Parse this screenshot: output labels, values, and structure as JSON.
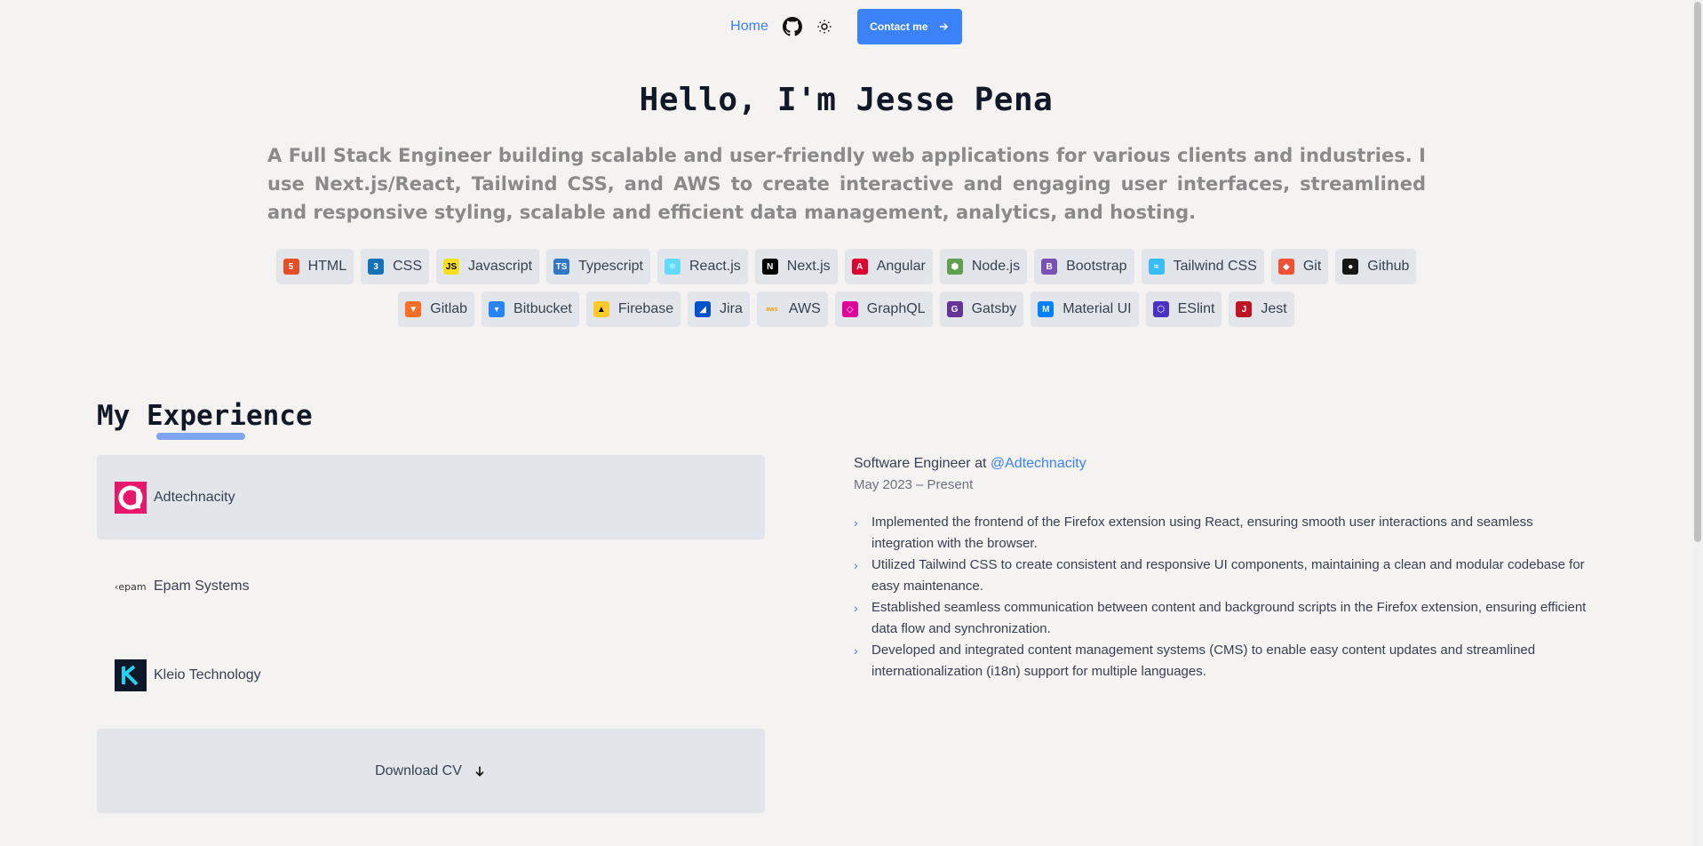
{
  "nav": {
    "home_label": "Home",
    "contact_label": "Contact me",
    "github_icon": "github-icon",
    "theme_icon": "sun-icon"
  },
  "hero": {
    "title": "Hello, I'm Jesse Pena",
    "subtitle": "A Full Stack Engineer building scalable and user-friendly web applications for various clients and industries. I use Next.js/React, Tailwind CSS, and AWS to create interactive and engaging user interfaces, streamlined and responsive styling, scalable and efficient data management, analytics, and hosting."
  },
  "skills": {
    "row1": [
      {
        "label": "HTML",
        "icon": "html5-icon",
        "color": "#e34f26",
        "glyph": "5"
      },
      {
        "label": "CSS",
        "icon": "css3-icon",
        "color": "#1572b6",
        "glyph": "3"
      },
      {
        "label": "Javascript",
        "icon": "javascript-icon",
        "color": "#f7df1e",
        "glyph": "JS"
      },
      {
        "label": "Typescript",
        "icon": "typescript-icon",
        "color": "#3178c6",
        "glyph": "TS"
      },
      {
        "label": "React.js",
        "icon": "react-icon",
        "color": "#61dafb",
        "glyph": "⚛"
      },
      {
        "label": "Next.js",
        "icon": "nextjs-icon",
        "color": "#000000",
        "glyph": "N"
      },
      {
        "label": "Angular",
        "icon": "angular-icon",
        "color": "#dd0031",
        "glyph": "A"
      },
      {
        "label": "Node.js",
        "icon": "nodejs-icon",
        "color": "#5fa04e",
        "glyph": "⬢"
      },
      {
        "label": "Bootstrap",
        "icon": "bootstrap-icon",
        "color": "#7952b3",
        "glyph": "B"
      },
      {
        "label": "Tailwind CSS",
        "icon": "tailwind-icon",
        "color": "#38bdf8",
        "glyph": "≈"
      },
      {
        "label": "Git",
        "icon": "git-icon",
        "color": "#f05032",
        "glyph": "◆"
      },
      {
        "label": "Github",
        "icon": "github-icon",
        "color": "#181717",
        "glyph": "●"
      }
    ],
    "row2": [
      {
        "label": "Gitlab",
        "icon": "gitlab-icon",
        "color": "#fc6d26",
        "glyph": "▼"
      },
      {
        "label": "Bitbucket",
        "icon": "bitbucket-icon",
        "color": "#2684ff",
        "glyph": "▾"
      },
      {
        "label": "Firebase",
        "icon": "firebase-icon",
        "color": "#ffca28",
        "glyph": "▲"
      },
      {
        "label": "Jira",
        "icon": "jira-icon",
        "color": "#0052cc",
        "glyph": "◢"
      },
      {
        "label": "AWS",
        "icon": "aws-icon",
        "color": "#ff9900",
        "glyph": "aws"
      },
      {
        "label": "GraphQL",
        "icon": "graphql-icon",
        "color": "#e10098",
        "glyph": "◇"
      },
      {
        "label": "Gatsby",
        "icon": "gatsby-icon",
        "color": "#663399",
        "glyph": "G"
      },
      {
        "label": "Material UI",
        "icon": "material-ui-icon",
        "color": "#007fff",
        "glyph": "M"
      },
      {
        "label": "ESlint",
        "icon": "eslint-icon",
        "color": "#4b32c3",
        "glyph": "⬡"
      },
      {
        "label": "Jest",
        "icon": "jest-icon",
        "color": "#c21325",
        "glyph": "J"
      }
    ]
  },
  "experience": {
    "title": "My Experience",
    "companies": [
      {
        "name": "Adtechnacity",
        "logo": "adtechnacity-logo-icon"
      },
      {
        "name": "Epam Systems",
        "logo": "epam-logo-icon"
      },
      {
        "name": "Kleio Technology",
        "logo": "kleio-logo-icon"
      }
    ],
    "download_label": "Download CV",
    "detail": {
      "role": "Software Engineer at ",
      "company_link": "@Adtechnacity",
      "dates": "May 2023 – Present",
      "bullets": [
        "Implemented the frontend of the Firefox extension using React, ensuring smooth user interactions and seamless integration with the browser.",
        "Utilized Tailwind CSS to create consistent and responsive UI components, maintaining a clean and modular codebase for easy maintenance.",
        "Established seamless communication between content and background scripts in the Firefox extension, ensuring efficient data flow and synchronization.",
        "Developed and integrated content management systems (CMS) to enable easy content updates and streamlined internationalization (i18n) support for multiple languages."
      ]
    }
  },
  "colors": {
    "accent": "#3b82f6",
    "background": "#f5f2f2",
    "chip": "#e2e6ea"
  }
}
